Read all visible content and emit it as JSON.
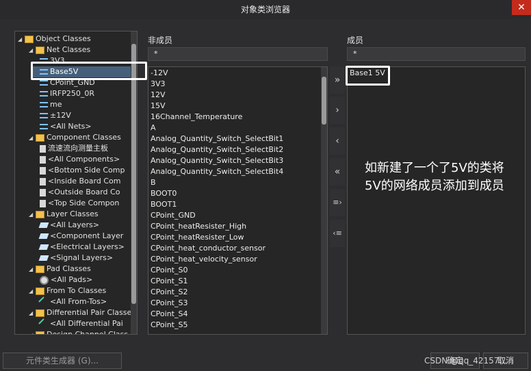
{
  "window": {
    "title": "对象类浏览器",
    "close_glyph": "✕"
  },
  "tree": {
    "items": [
      {
        "label": "Object Classes",
        "icon": "folder-icon",
        "arrow": "◢"
      },
      {
        "label": "Net Classes",
        "icon": "folder-icon",
        "arrow": "◢"
      },
      {
        "label": "3V3",
        "icon": "net-class-icon"
      },
      {
        "label": "Base5V",
        "icon": "net-class-icon"
      },
      {
        "label": "CPoint_GND",
        "icon": "net-class-icon"
      },
      {
        "label": "IRFP250_0R",
        "icon": "net-class-icon"
      },
      {
        "label": "me",
        "icon": "net-class-icon"
      },
      {
        "label": "±12V",
        "icon": "net-class-icon"
      },
      {
        "label": "<All Nets>",
        "icon": "net-class-icon"
      },
      {
        "label": "Component Classes",
        "icon": "folder-icon",
        "arrow": "◢"
      },
      {
        "label": "流速流向测量主板",
        "icon": "component-icon"
      },
      {
        "label": "<All Components>",
        "icon": "component-icon"
      },
      {
        "label": "<Bottom Side Comp",
        "icon": "component-icon"
      },
      {
        "label": "<Inside Board Com",
        "icon": "component-icon"
      },
      {
        "label": "<Outside Board Co",
        "icon": "component-icon"
      },
      {
        "label": "<Top Side Compon",
        "icon": "component-icon"
      },
      {
        "label": "Layer Classes",
        "icon": "folder-icon",
        "arrow": "◢"
      },
      {
        "label": "<All Layers>",
        "icon": "layer-icon"
      },
      {
        "label": "<Component Layer",
        "icon": "layer-icon"
      },
      {
        "label": "<Electrical Layers>",
        "icon": "layer-icon"
      },
      {
        "label": "<Signal Layers>",
        "icon": "layer-icon"
      },
      {
        "label": "Pad Classes",
        "icon": "folder-icon",
        "arrow": "◢"
      },
      {
        "label": "<All Pads>",
        "icon": "pad-icon"
      },
      {
        "label": "From To Classes",
        "icon": "folder-icon",
        "arrow": "◢"
      },
      {
        "label": "<All From-Tos>",
        "icon": "from-to-icon"
      },
      {
        "label": "Differential Pair Classe",
        "icon": "folder-icon",
        "arrow": "◢"
      },
      {
        "label": "<All Differential Pai",
        "icon": "from-to-icon"
      },
      {
        "label": "Design Channel Class",
        "icon": "folder-icon",
        "arrow": "◢"
      }
    ]
  },
  "non_members": {
    "heading": "非成员",
    "filter": "*",
    "items": [
      "-12V",
      "3V3",
      "12V",
      "15V",
      "16Channel_Temperature",
      "A",
      "Analog_Quantity_Switch_SelectBit1",
      "Analog_Quantity_Switch_SelectBit2",
      "Analog_Quantity_Switch_SelectBit3",
      "Analog_Quantity_Switch_SelectBit4",
      "B",
      "BOOT0",
      "BOOT1",
      "CPoint_GND",
      "CPoint_heatResister_High",
      "CPoint_heatResister_Low",
      "CPoint_heat_conductor_sensor",
      "CPoint_heat_velocity_sensor",
      "CPoint_S0",
      "CPoint_S1",
      "CPoint_S2",
      "CPoint_S3",
      "CPoint_S4",
      "CPoint_S5"
    ]
  },
  "transfer_buttons": {
    "add_all": "»",
    "add": "›",
    "remove": "‹",
    "remove_all": "«",
    "add_selected": "≡›",
    "remove_selected": "‹≡"
  },
  "members": {
    "heading": "成员",
    "filter": "*",
    "items": [
      "Base1 5V"
    ]
  },
  "annotation": {
    "text": "如新建了一个了5V的类将5V的网络成员添加到成员"
  },
  "footer": {
    "generator_button": "元件类生成器 (G)...",
    "ok_button": "确定",
    "cancel_button": "取消",
    "watermark": "CSDN @qq_42157..."
  }
}
